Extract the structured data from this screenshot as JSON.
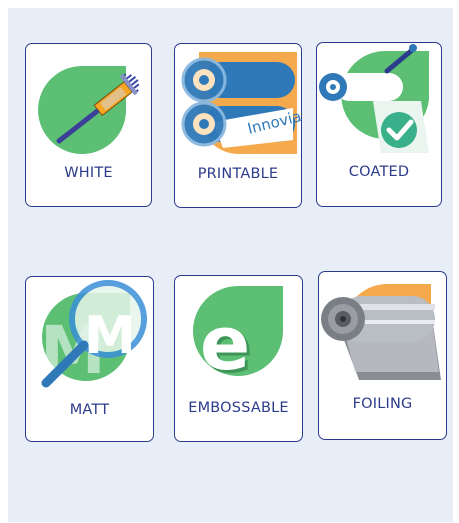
{
  "cards": [
    {
      "label": "WHITE",
      "icon": "paintbrush-icon"
    },
    {
      "label": "PRINTABLE",
      "icon": "printing-rolls-icon",
      "roll_text": "Innovia"
    },
    {
      "label": "COATED",
      "icon": "coating-roller-check-icon"
    },
    {
      "label": "MATT",
      "icon": "magnifier-m-icon"
    },
    {
      "label": "EMBOSSABLE",
      "icon": "embossed-e-icon"
    },
    {
      "label": "FOILING",
      "icon": "foil-roll-icon"
    }
  ],
  "colors": {
    "green": "#5cbf73",
    "orange": "#f4a94c",
    "blue": "#2f79b9",
    "navy": "#2c3c8c",
    "panel": "#e8eef7"
  }
}
